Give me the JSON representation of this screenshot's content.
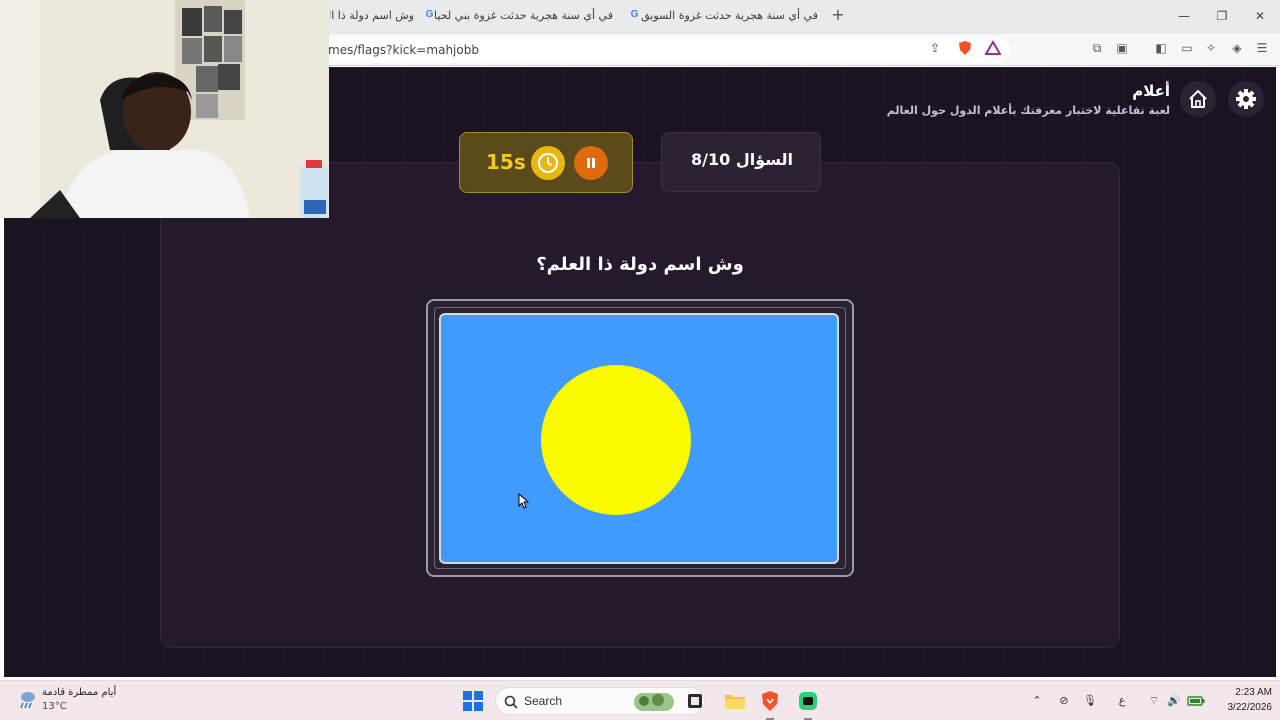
{
  "browser": {
    "tabs": [
      {
        "title": "وش اسم دولة ذا ال"
      },
      {
        "title": "في أي سنة هجرية حدثت غزوة بني لحيا"
      },
      {
        "title": "في أي سنة هجرية حدثت غزوة السويق"
      }
    ],
    "new_tab_glyph": "+",
    "url": "mes/flags?kick=mahjobb"
  },
  "app": {
    "title": "أعلام",
    "subtitle": "لعبة تفاعلية لاختبار معرفتك بأعلام الدول حول العالم"
  },
  "game": {
    "timer": "15s",
    "question_counter": "السؤال 8/10",
    "question": "وش اسم دولة ذا العلم؟",
    "flag_colors": {
      "field": "#419bfc",
      "disk": "#fbfb00"
    }
  },
  "colors": {
    "background": "#1c1322",
    "card": "#241a2c",
    "timer_accent": "#f7c81e",
    "pause_accent": "#e06a10"
  },
  "taskbar": {
    "weather_text": "أيام ممطرة قادمة",
    "weather_temp": "13°C",
    "search_label": "Search",
    "time": "2:23 AM",
    "date": "3/22/2026",
    "language": "ع"
  }
}
